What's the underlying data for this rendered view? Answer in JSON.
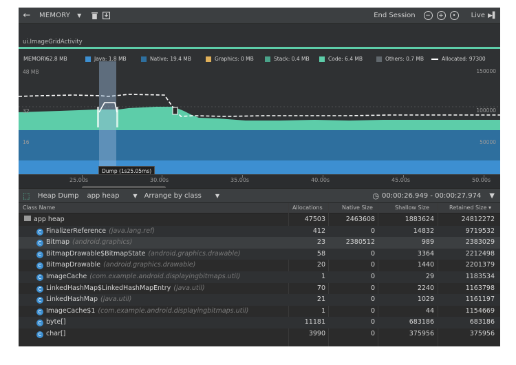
{
  "toolbar": {
    "back_icon": "arrow-left-icon",
    "profiler": "MEMORY",
    "end_session": "End Session",
    "live": "Live"
  },
  "activity": {
    "name": "ui.ImageGridActivity"
  },
  "legend": {
    "title": "MEMORY",
    "total": "62.8 MB",
    "items": [
      {
        "label": "Java: 1.8 MB",
        "color": "#3d8fd1"
      },
      {
        "label": "Native: 19.4 MB",
        "color": "#2e6f9e"
      },
      {
        "label": "Graphics: 0 MB",
        "color": "#e0b05a"
      },
      {
        "label": "Stack: 0.4 MB",
        "color": "#4aa38a"
      },
      {
        "label": "Code: 6.4 MB",
        "color": "#5dcda9"
      },
      {
        "label": "Others: 0.7 MB",
        "color": "#60676c"
      },
      {
        "label": "Allocated: 97300",
        "color": "#ffffff"
      }
    ]
  },
  "yaxis": {
    "left": [
      "48 MB",
      "32",
      "16"
    ],
    "right": [
      "150000",
      "100000",
      "50000"
    ]
  },
  "xaxis": {
    "ticks": [
      "25.00s",
      "30.00s",
      "35.00s",
      "40.00s",
      "45.00s",
      "50.00s"
    ]
  },
  "tooltip": "Dump (1s25.05ms)",
  "heap": {
    "label": "Heap Dump",
    "heap_select": "app heap",
    "arrange_select": "Arrange by class",
    "range": "00:00:26.949 - 00:00:27.974"
  },
  "table": {
    "columns": [
      "Class Name",
      "Allocations",
      "Native Size",
      "Shallow Size",
      "Retained Size ▾"
    ],
    "rows": [
      {
        "name": "app heap",
        "pkg": "",
        "alloc": "47503",
        "native": "2463608",
        "shallow": "1883624",
        "retained": "24812272",
        "root": true
      },
      {
        "name": "FinalizerReference",
        "pkg": "(java.lang.ref)",
        "alloc": "412",
        "native": "0",
        "shallow": "14832",
        "retained": "9719532"
      },
      {
        "name": "Bitmap",
        "pkg": "(android.graphics)",
        "alloc": "23",
        "native": "2380512",
        "shallow": "989",
        "retained": "2383029"
      },
      {
        "name": "BitmapDrawable$BitmapState",
        "pkg": "(android.graphics.drawable)",
        "alloc": "58",
        "native": "0",
        "shallow": "3364",
        "retained": "2212498"
      },
      {
        "name": "BitmapDrawable",
        "pkg": "(android.graphics.drawable)",
        "alloc": "20",
        "native": "0",
        "shallow": "1440",
        "retained": "2201379"
      },
      {
        "name": "ImageCache",
        "pkg": "(com.example.android.displayingbitmaps.util)",
        "alloc": "1",
        "native": "0",
        "shallow": "29",
        "retained": "1183534"
      },
      {
        "name": "LinkedHashMap$LinkedHashMapEntry",
        "pkg": "(java.util)",
        "alloc": "70",
        "native": "0",
        "shallow": "2240",
        "retained": "1163798"
      },
      {
        "name": "LinkedHashMap",
        "pkg": "(java.util)",
        "alloc": "21",
        "native": "0",
        "shallow": "1029",
        "retained": "1161197"
      },
      {
        "name": "ImageCache$1",
        "pkg": "(com.example.android.displayingbitmaps.util)",
        "alloc": "1",
        "native": "0",
        "shallow": "44",
        "retained": "1154669"
      },
      {
        "name": "byte[]",
        "pkg": "",
        "alloc": "11181",
        "native": "0",
        "shallow": "683186",
        "retained": "683186"
      },
      {
        "name": "char[]",
        "pkg": "",
        "alloc": "3990",
        "native": "0",
        "shallow": "375956",
        "retained": "375956"
      }
    ]
  }
}
